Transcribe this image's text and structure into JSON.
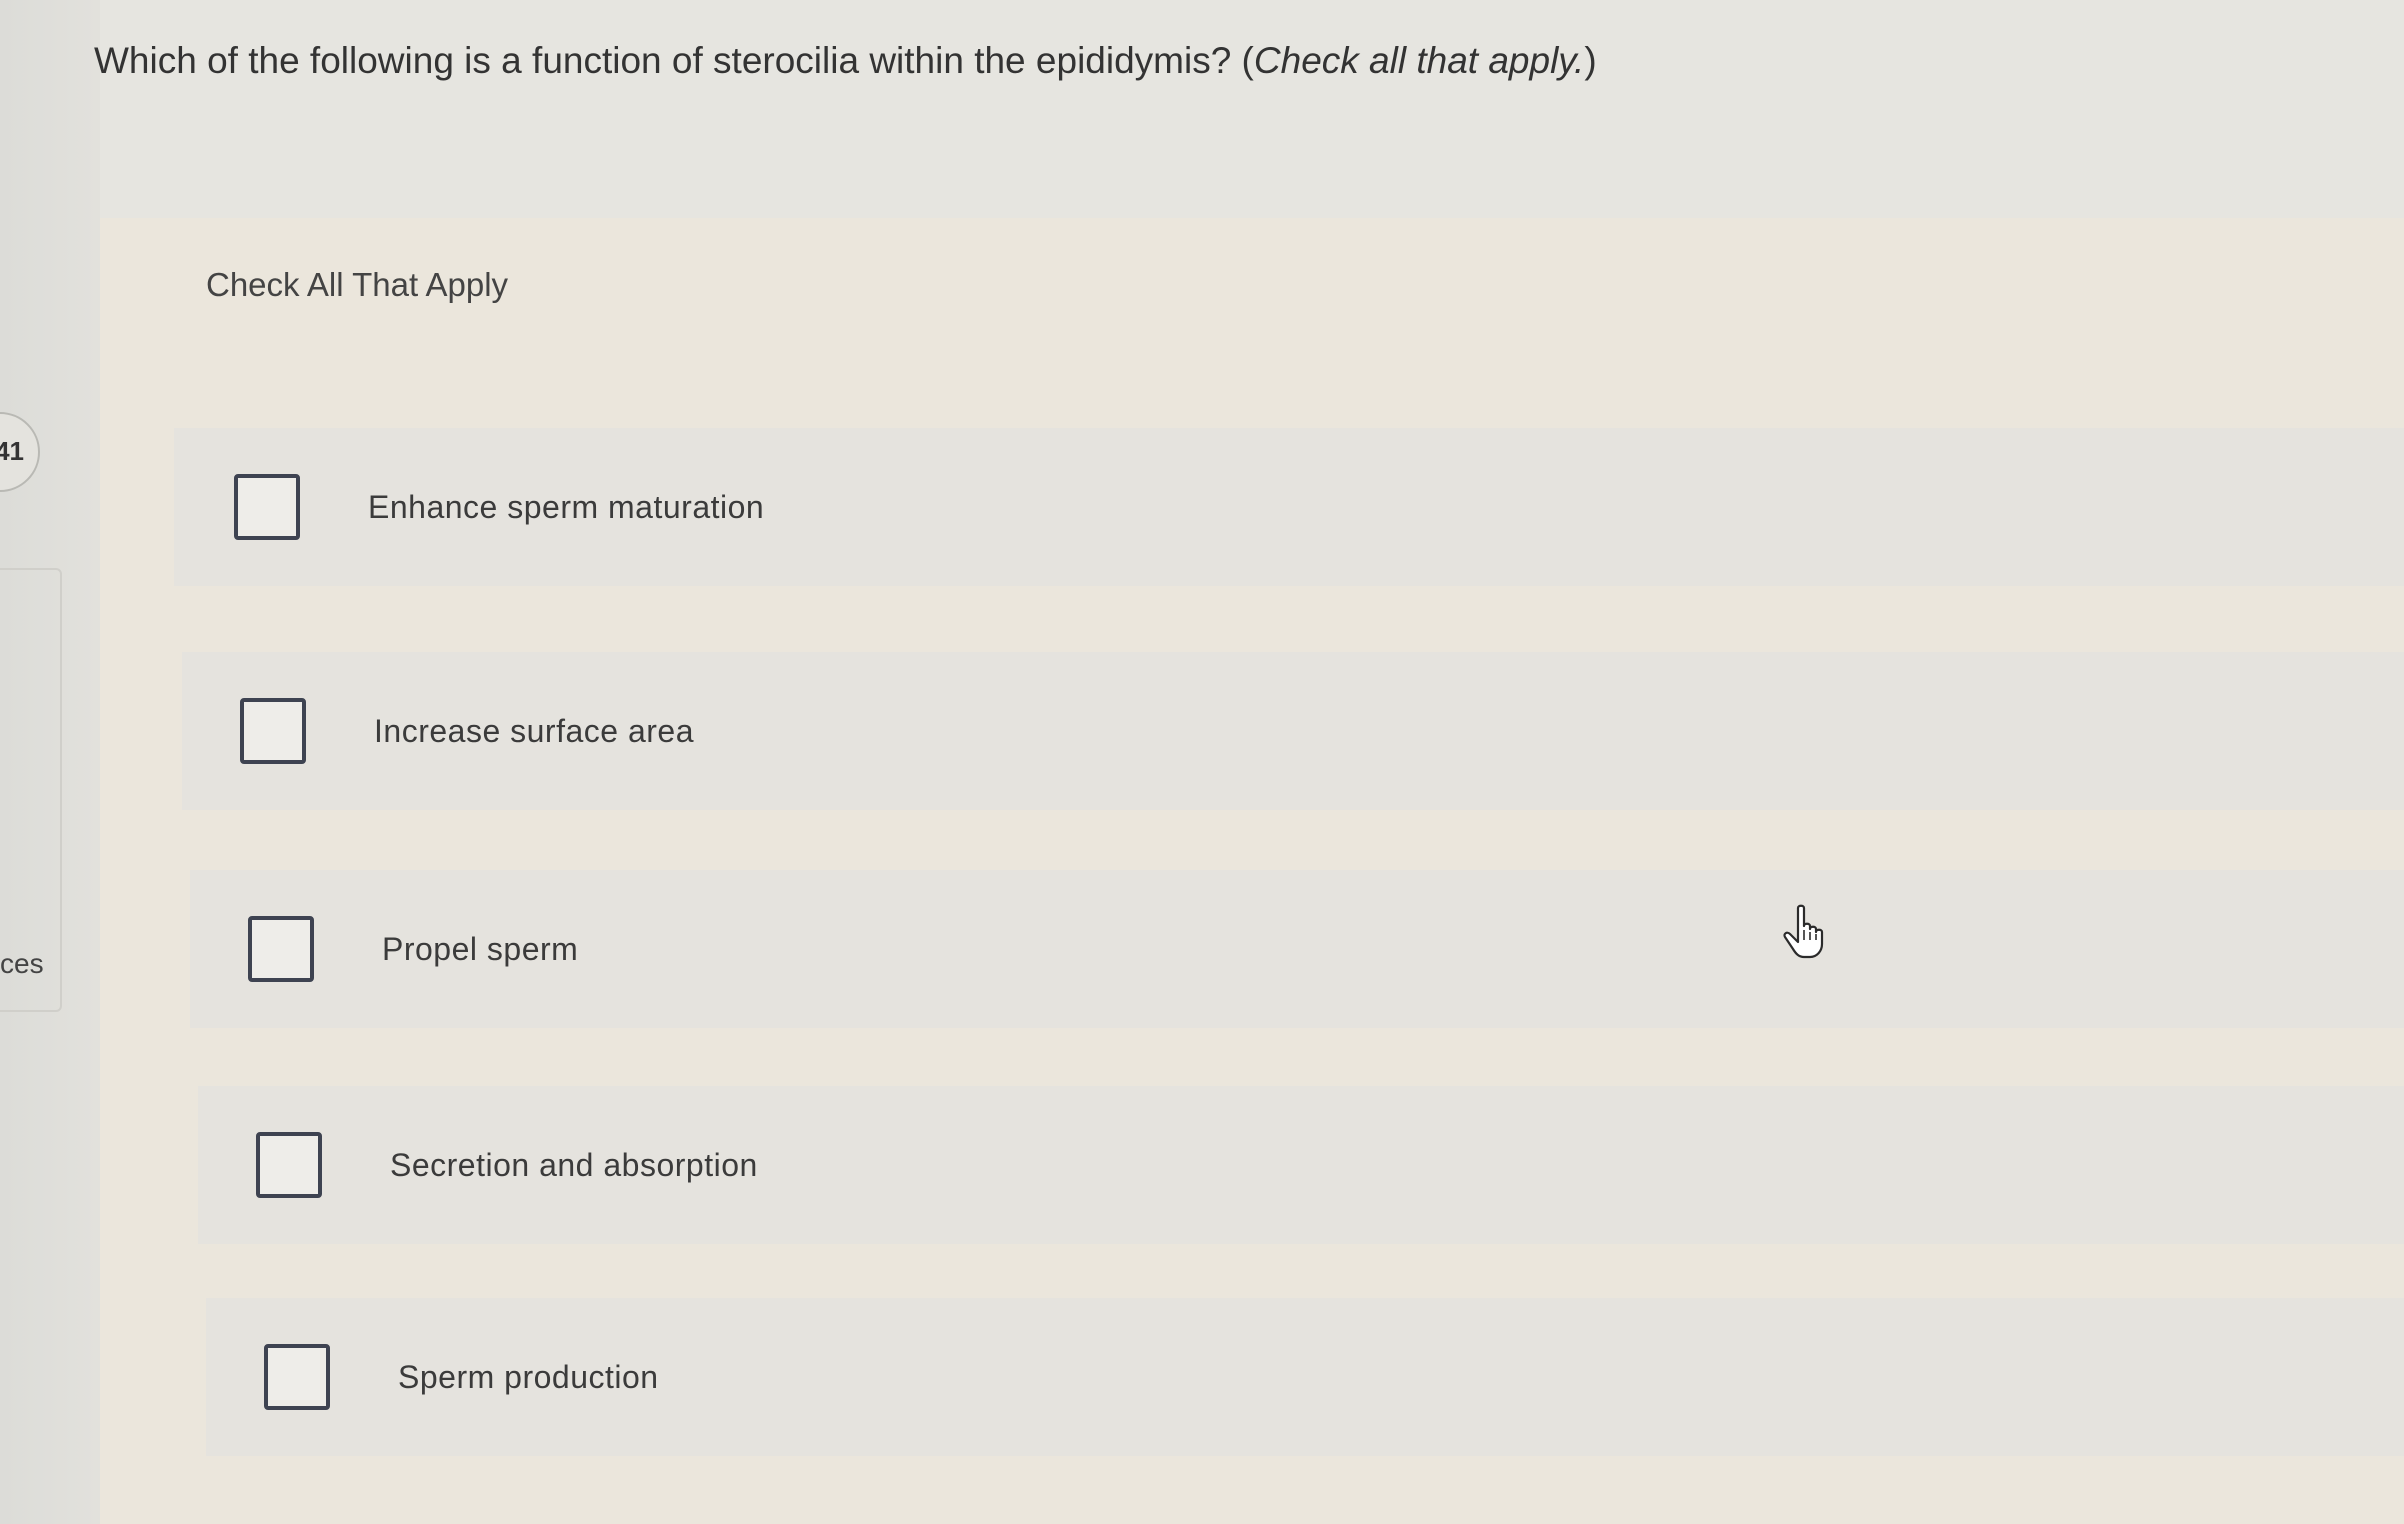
{
  "question": {
    "text": "Which of the following is a function of sterocilia within the epididymis? (",
    "instruction": "Check all that apply.",
    "close": ")"
  },
  "sidebar": {
    "badge_number": "41",
    "partial_label": "ces"
  },
  "card": {
    "heading": "Check All That Apply",
    "options": [
      {
        "label": "Enhance sperm maturation",
        "checked": false
      },
      {
        "label": "Increase surface area",
        "checked": false
      },
      {
        "label": "Propel sperm",
        "checked": false
      },
      {
        "label": "Secretion and absorption",
        "checked": false
      },
      {
        "label": "Sperm production",
        "checked": false
      }
    ]
  },
  "icons": {
    "cursor": "hand-pointer-icon"
  }
}
